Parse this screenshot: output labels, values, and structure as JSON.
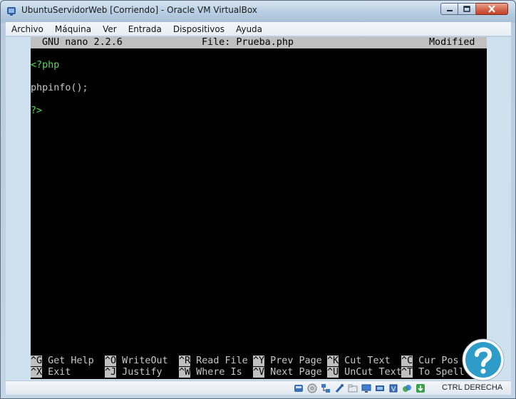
{
  "window": {
    "title": "UbuntuServidorWeb [Corriendo] - Oracle VM VirtualBox",
    "icon": "virtualbox-icon"
  },
  "menubar": {
    "items": [
      "Archivo",
      "Máquina",
      "Ver",
      "Entrada",
      "Dispositivos",
      "Ayuda"
    ]
  },
  "nano": {
    "header": {
      "version": "GNU nano 2.2.6",
      "file": "File: Prueba.php",
      "status": "Modified"
    },
    "lines": [
      "<?php",
      "",
      "phpinfo();",
      "",
      "?>"
    ],
    "shortcuts": [
      {
        "key": "^G",
        "label": " Get Help  "
      },
      {
        "key": "^O",
        "label": " WriteOut  "
      },
      {
        "key": "^R",
        "label": " Read File "
      },
      {
        "key": "^Y",
        "label": " Prev Page "
      },
      {
        "key": "^K",
        "label": " Cut Text  "
      },
      {
        "key": "^C",
        "label": " Cur Pos"
      },
      {
        "key": "^X",
        "label": " Exit      "
      },
      {
        "key": "^J",
        "label": " Justify   "
      },
      {
        "key": "^W",
        "label": " Where Is  "
      },
      {
        "key": "^V",
        "label": " Next Page "
      },
      {
        "key": "^U",
        "label": " UnCut Text"
      },
      {
        "key": "^T",
        "label": " To Spell"
      }
    ],
    "colors": {
      "keyword": "#55dd55",
      "text": "#c8c8c8",
      "background": "#000000",
      "bar": "#c0c0c0"
    }
  },
  "statusbar": {
    "host_key": "CTRL DERECHA",
    "icons": [
      "hard-disk-icon",
      "optical-drive-icon",
      "network-icon",
      "usb-icon",
      "shared-folders-icon",
      "display-icon",
      "video-capture-icon",
      "cpu-virtualization-icon",
      "mouse-integration-icon",
      "keyboard-capture-icon"
    ]
  }
}
